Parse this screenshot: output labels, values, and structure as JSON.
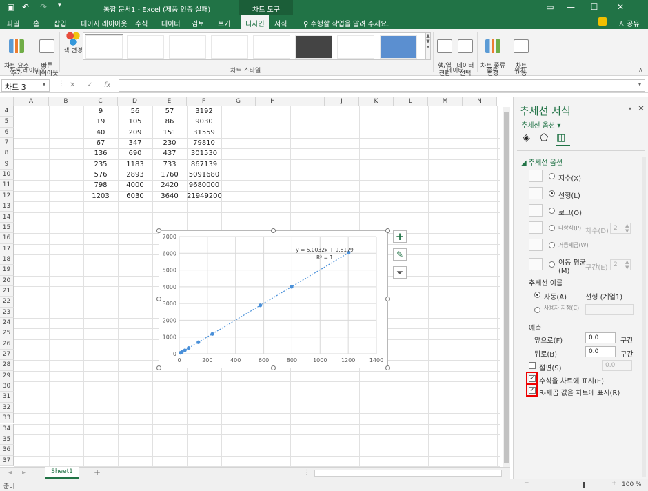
{
  "titlebar": {
    "title": "통합 문서1 - Excel (제품 인증 실패)",
    "context_tab": "차트 도구",
    "save_icon": "save-icon",
    "undo": "↶",
    "redo": "↷"
  },
  "tabs": {
    "items": [
      "파일",
      "홈",
      "삽입",
      "페이지 레이아웃",
      "수식",
      "데이터",
      "검토",
      "보기",
      "디자인",
      "서식"
    ],
    "active": "디자인",
    "tellme": "수행할 작업을 알려 주세요.",
    "share": "공유"
  },
  "ribbon": {
    "add_element": "차트 요소\n추가",
    "quick_layout": "빠른\n레이아웃",
    "change_color": "색 변경",
    "switch_row_col": "행/열\n전환",
    "select_data": "데이터\n선택",
    "change_type": "차트 종류\n변경",
    "move_chart": "차트\n이동",
    "groups": {
      "layout": "차트 레이아웃",
      "styles": "차트 스타일",
      "data": "데이터",
      "type": "종류",
      "location": "위치"
    }
  },
  "formula": {
    "namebox": "차트 3",
    "cancel": "✕",
    "enter": "✓",
    "fx": "fx",
    "value": ""
  },
  "grid": {
    "columns": [
      "A",
      "B",
      "C",
      "D",
      "E",
      "F",
      "G",
      "H",
      "I",
      "J",
      "K",
      "L",
      "M",
      "N"
    ],
    "rows": [
      "4",
      "5",
      "6",
      "7",
      "8",
      "9",
      "10",
      "11",
      "12",
      "13",
      "14",
      "15",
      "16",
      "17",
      "18",
      "19",
      "20",
      "21",
      "22",
      "23",
      "24",
      "25",
      "26",
      "27",
      "28",
      "29",
      "30",
      "31",
      "32",
      "33",
      "34",
      "35",
      "36",
      "37"
    ],
    "data": [
      [
        "9",
        "56",
        "57",
        "3192"
      ],
      [
        "19",
        "105",
        "86",
        "9030"
      ],
      [
        "40",
        "209",
        "151",
        "31559"
      ],
      [
        "67",
        "347",
        "230",
        "79810"
      ],
      [
        "136",
        "690",
        "437",
        "301530"
      ],
      [
        "235",
        "1183",
        "733",
        "867139"
      ],
      [
        "576",
        "2893",
        "1760",
        "5091680"
      ],
      [
        "798",
        "4000",
        "2420",
        "9680000"
      ],
      [
        "1203",
        "6030",
        "3640",
        "21949200"
      ]
    ]
  },
  "sheet": {
    "tab": "Sheet1",
    "add": "+",
    "status": "준비",
    "zoom": "100 %"
  },
  "chart_data": {
    "type": "scatter",
    "x": [
      9,
      19,
      40,
      67,
      136,
      235,
      576,
      798,
      1203
    ],
    "y": [
      56,
      105,
      209,
      347,
      690,
      1183,
      2893,
      4000,
      6030
    ],
    "xlim": [
      0,
      1400
    ],
    "ylim": [
      0,
      7000
    ],
    "xticks": [
      "0",
      "200",
      "400",
      "600",
      "800",
      "1000",
      "1200",
      "1400"
    ],
    "yticks": [
      "0",
      "1000",
      "2000",
      "3000",
      "4000",
      "5000",
      "6000",
      "7000"
    ],
    "trendline": {
      "type": "linear",
      "slope": 5.0032,
      "intercept": 9.8179,
      "equation": "y = 5.0032x + 9.8179",
      "r2": "R² = 1"
    },
    "grid": true,
    "series_color": "#4a90d9"
  },
  "pane": {
    "title": "추세선 서식",
    "options_dropdown": "추세선 옵션",
    "section": "추세선 옵션",
    "types": [
      {
        "label": "지수(X)",
        "selected": false,
        "disabled": false
      },
      {
        "label": "선형(L)",
        "selected": true,
        "disabled": false
      },
      {
        "label": "로그(O)",
        "selected": false,
        "disabled": false
      },
      {
        "label": "다항식(P)",
        "selected": false,
        "disabled": true
      },
      {
        "label": "거듭제곱(W)",
        "selected": false,
        "disabled": true
      },
      {
        "label": "이동 평균(M)",
        "selected": false,
        "disabled": false
      }
    ],
    "order_label": "차수(D)",
    "order_value": "2",
    "period_label": "구간(E)",
    "period_value": "2",
    "name_label": "추세선 이름",
    "auto_label": "자동(A)",
    "auto_value": "선형 (계열1)",
    "custom_label": "사용자 지정(C)",
    "forecast_label": "예측",
    "forward_label": "앞으로(F)",
    "forward_value": "0.0",
    "forward_unit": "구간",
    "backward_label": "뒤로(B)",
    "backward_value": "0.0",
    "backward_unit": "구간",
    "intercept_label": "절편(S)",
    "intercept_value": "0.0",
    "show_eq_label": "수식을 차트에 표시(E)",
    "show_r2_label": "R-제곱 값을 차트에 표시(R)",
    "accent": "#217346"
  }
}
